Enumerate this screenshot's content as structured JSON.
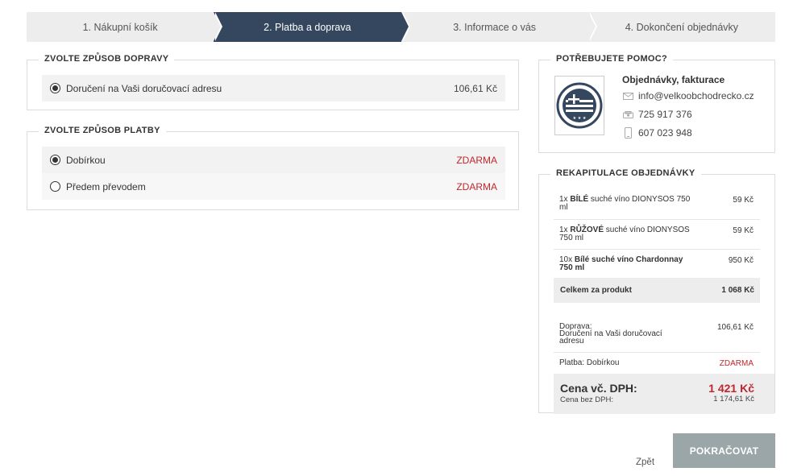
{
  "steps": [
    {
      "label": "1. Nákupní košík",
      "active": false
    },
    {
      "label": "2. Platba a doprava",
      "active": true
    },
    {
      "label": "3. Informace o vás",
      "active": false
    },
    {
      "label": "4. Dokončení objednávky",
      "active": false
    }
  ],
  "shipping": {
    "legend": "ZVOLTE ZPŮSOB DOPRAVY",
    "options": [
      {
        "label": "Doručení na Vaši doručovací adresu",
        "price": "106,61 Kč",
        "selected": true
      }
    ]
  },
  "payment": {
    "legend": "ZVOLTE ZPŮSOB PLATBY",
    "options": [
      {
        "label": "Dobírkou",
        "price": "ZDARMA",
        "selected": true
      },
      {
        "label": "Předem převodem",
        "price": "ZDARMA",
        "selected": false
      }
    ]
  },
  "help": {
    "legend": "POTŘEBUJETE POMOC?",
    "title": "Objednávky, fakturace",
    "email": "info@velkoobchodrecko.cz",
    "phone": "725 917 376",
    "mobile": "607 023 948"
  },
  "summary": {
    "legend": "REKAPITULACE OBJEDNÁVKY",
    "items": [
      {
        "qty": "1x",
        "name_bold": "BÍLÉ",
        "name_rest": " suché víno DIONYSOS 750 ml",
        "price": "59 Kč"
      },
      {
        "qty": "1x",
        "name_bold": "RŮŽOVÉ",
        "name_rest": " suché víno DIONYSOS 750 ml",
        "price": "59 Kč"
      },
      {
        "qty": "10x",
        "name_bold": "Bílé suché víno Chardonnay 750 ml",
        "name_rest": "",
        "price": "950 Kč"
      }
    ],
    "products_total_label": "Celkem za produkt",
    "products_total": "1 068 Kč",
    "shipping_label": "Doprava:",
    "shipping_name": "Doručení na Vaši doručovací adresu",
    "shipping_price": "106,61 Kč",
    "payment_label": "Platba:",
    "payment_name": "Dobírkou",
    "payment_price": "ZDARMA",
    "total_label": "Cena vč. DPH:",
    "total": "1 421 Kč",
    "total_no_vat_label": "Cena bez DPH:",
    "total_no_vat": "1 174,61 Kč"
  },
  "actions": {
    "back": "Zpět",
    "continue": "POKRAČOVAT"
  },
  "colors": {
    "active_step": "#34475e",
    "accent_red": "#c0272d",
    "button": "#9aa6a7"
  }
}
